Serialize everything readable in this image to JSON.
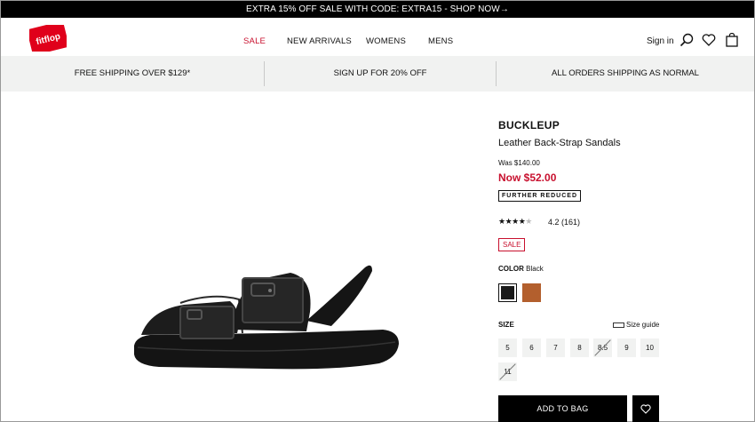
{
  "promo": {
    "text": "EXTRA 15% OFF SALE WITH CODE: EXTRA15 - SHOP NOW→"
  },
  "header": {
    "logo_text": "fitflop",
    "nav": [
      "SALE",
      "NEW ARRIVALS",
      "WOMENS",
      "MENS"
    ],
    "signin": "Sign in",
    "icons": [
      "search-icon",
      "heart-icon",
      "bag-icon"
    ]
  },
  "strip": [
    "FREE SHIPPING OVER $129*",
    "SIGN UP FOR 20% OFF",
    "ALL ORDERS SHIPPING AS NORMAL"
  ],
  "product": {
    "brand": "BUCKLEUP",
    "name": "Leather Back-Strap Sandals",
    "was": "Was $140.00",
    "now": "Now $52.00",
    "badge": "FURTHER REDUCED",
    "rating": {
      "value": 4.2,
      "stars_text": "4.2",
      "count": "(161)"
    },
    "sale_badge": "SALE",
    "color_label": "COLOR",
    "color_value": "Black",
    "swatches": [
      {
        "name": "Black",
        "hex": "#1a1a1a",
        "selected": true
      },
      {
        "name": "Tan",
        "hex": "#b35f2d",
        "selected": false
      }
    ],
    "size_label": "SIZE",
    "size_guide": "Size guide",
    "sizes": [
      {
        "label": "5",
        "available": true
      },
      {
        "label": "6",
        "available": true
      },
      {
        "label": "7",
        "available": true
      },
      {
        "label": "8",
        "available": true
      },
      {
        "label": "8.5",
        "available": false
      },
      {
        "label": "9",
        "available": true
      },
      {
        "label": "10",
        "available": true
      },
      {
        "label": "11",
        "available": false
      }
    ],
    "add_to_bag": "ADD TO BAG"
  },
  "colors": {
    "accent_red": "#c8102e",
    "strip_bg": "#f1f2f1",
    "black": "#000000"
  }
}
